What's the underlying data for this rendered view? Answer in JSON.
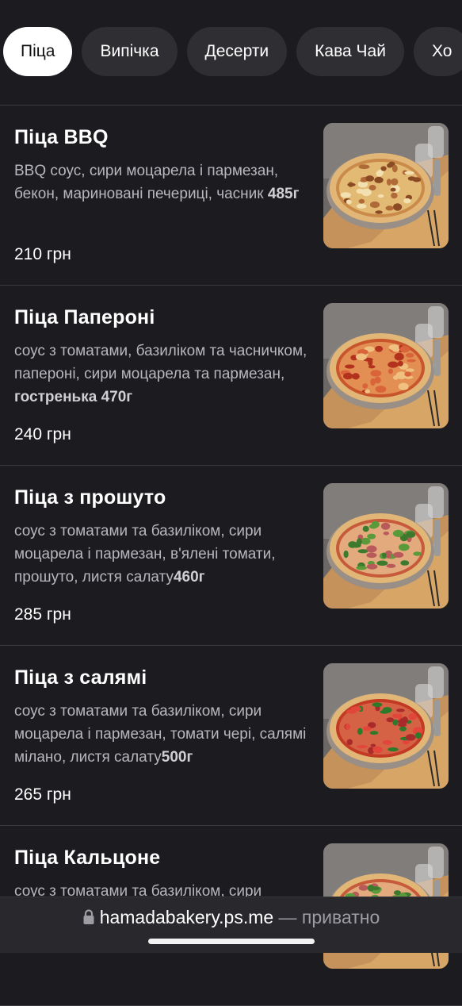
{
  "tabs": [
    {
      "label": "Піца",
      "active": true
    },
    {
      "label": "Випічка",
      "active": false
    },
    {
      "label": "Десерти",
      "active": false
    },
    {
      "label": "Кава Чай",
      "active": false
    },
    {
      "label": "Хо",
      "active": false
    }
  ],
  "items": [
    {
      "name": "Піца BBQ",
      "desc": "BBQ соус, сири моцарела і пармезан, бекон, мариновані печериці, часник ",
      "desc_bold": "485г",
      "price": "210 грн",
      "topping": "bbq"
    },
    {
      "name": "Піца Папероні",
      "desc": "соус з томатами, базиліком та часничком, папероні, сири моцарела та пармезан, ",
      "desc_bold": "гостренька 470г",
      "price": "240 грн",
      "topping": "pepperoni"
    },
    {
      "name": "Піца з прошуто",
      "desc": "соус з томатами та базиліком, сири моцарела і пармезан, в'ялені томати, прошуто, листя салату",
      "desc_bold": "460г",
      "price": "285 грн",
      "topping": "prosciutto"
    },
    {
      "name": "Піца з салямі",
      "desc": "соус з томатами та базиліком, сири моцарела і пармезан, томати чері, салямі мілано, листя салату",
      "desc_bold": "500г",
      "price": "265 грн",
      "topping": "salami"
    },
    {
      "name": "Піца Кальцоне",
      "desc": "соус з томатами та базиліком, сири",
      "desc_bold": "",
      "price": "",
      "topping": "calzone"
    }
  ],
  "browser": {
    "url": "hamadabakery.ps.me",
    "suffix": " — приватно"
  }
}
